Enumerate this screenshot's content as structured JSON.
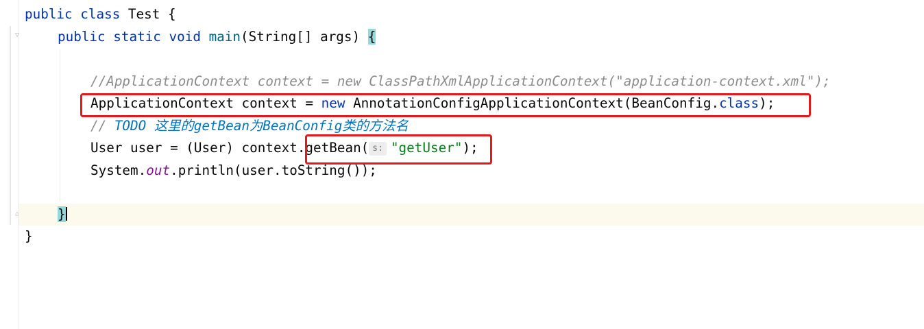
{
  "editor": {
    "lines": {
      "l1": {
        "kw1": "public class ",
        "name": "Test",
        "rest": " {"
      },
      "l2": {
        "kw1": "public static void ",
        "fn": "main",
        "rest": "(String[] args) ",
        "brace": "{"
      },
      "l4": {
        "comment": "//ApplicationContext context = new ClassPathXmlApplicationContext(\"application-context.xml\");"
      },
      "l5": {
        "a": "ApplicationContext context = ",
        "kw": "new",
        "b": " AnnotationConfigApplicationContext(BeanConfig.",
        "kw2": "class",
        "c": ");"
      },
      "l6": {
        "prefix": "// ",
        "todo": "TODO 这里的getBean为BeanConfig类的方法名"
      },
      "l7": {
        "a": "User user = (User) context.getBean(",
        "hint": "s:",
        "str": "\"getUser\"",
        "c": ");"
      },
      "l8": {
        "a": "System.",
        "field": "out",
        "b": ".println(user.toString());"
      },
      "l10": {
        "brace": "}"
      },
      "l11": {
        "brace": "}"
      }
    },
    "colors": {
      "keyword": "#0033b3",
      "method": "#00627a",
      "comment": "#8c8c8c",
      "todo": "#0073bf",
      "string": "#067d17",
      "static_field": "#871094",
      "annotation_box": "#e5191a",
      "current_line": "#fcfaed"
    }
  }
}
